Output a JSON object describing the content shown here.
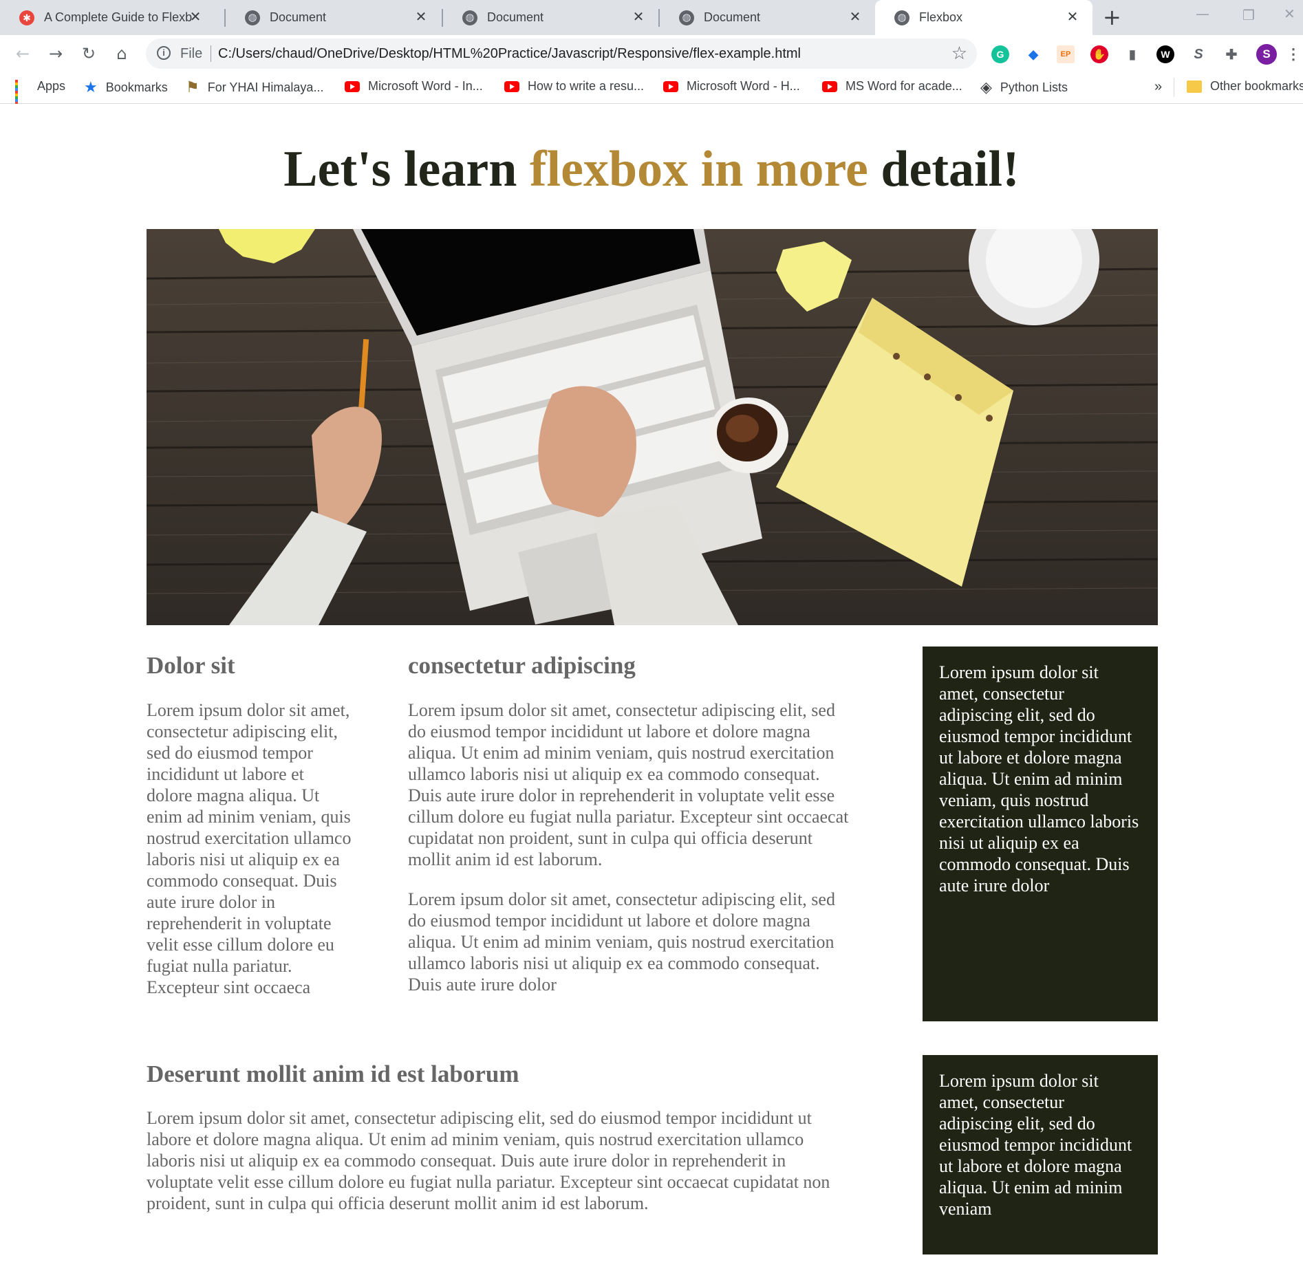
{
  "browser": {
    "tabs": [
      {
        "title": "A Complete Guide to Flexbox",
        "favicon": "guide-icon"
      },
      {
        "title": "Document",
        "favicon": "globe-icon"
      },
      {
        "title": "Document",
        "favicon": "globe-icon"
      },
      {
        "title": "Document",
        "favicon": "globe-icon"
      },
      {
        "title": "Flexbox",
        "favicon": "globe-icon",
        "active": true
      }
    ],
    "omnibox": {
      "scheme": "File",
      "url": "C:/Users/chaud/OneDrive/Desktop/HTML%20Practice/Javascript/Responsive/flex-example.html"
    },
    "profile_initial": "S",
    "bookmarks": [
      {
        "label": "Apps",
        "icon": "apps-icon"
      },
      {
        "label": "Bookmarks",
        "icon": "star-icon"
      },
      {
        "label": "For YHAI Himalaya...",
        "icon": "signpost-icon"
      },
      {
        "label": "Microsoft Word - In...",
        "icon": "youtube-icon"
      },
      {
        "label": "How to write a resu...",
        "icon": "youtube-icon"
      },
      {
        "label": "Microsoft Word - H...",
        "icon": "youtube-icon"
      },
      {
        "label": "MS Word for acade...",
        "icon": "youtube-icon"
      },
      {
        "label": "Python Lists",
        "icon": "python-icon"
      }
    ],
    "overflow": "»",
    "other_bookmarks": "Other bookmarks"
  },
  "page": {
    "title_before": "Let's learn ",
    "title_accent": "flexbox in more",
    "title_after": " detail!",
    "colors": {
      "heading": "#22261a",
      "accent": "#b38935",
      "text": "#666666",
      "aside_bg": "#1f2414"
    },
    "hero_image": "laptop-desk-photo",
    "sections": {
      "col1": {
        "heading": "Dolor sit",
        "text": "Lorem ipsum dolor sit amet, consectetur adipiscing elit, sed do eiusmod tempor incididunt ut labore et dolore magna aliqua. Ut enim ad minim veniam, quis nostrud exercitation ullamco laboris nisi ut aliquip ex ea commodo consequat. Duis aute irure dolor in reprehenderit in voluptate velit esse cillum dolore eu fugiat nulla pariatur. Excepteur sint occaeca"
      },
      "col2": {
        "heading": "consectetur adipiscing",
        "text1": "Lorem ipsum dolor sit amet, consectetur adipiscing elit, sed do eiusmod tempor incididunt ut labore et dolore magna aliqua. Ut enim ad minim veniam, quis nostrud exercitation ullamco laboris nisi ut aliquip ex ea commodo consequat. Duis aute irure dolor in reprehenderit in voluptate velit esse cillum dolore eu fugiat nulla pariatur. Excepteur sint occaecat cupidatat non proident, sunt in culpa qui officia deserunt mollit anim id est laborum.",
        "text2": "Lorem ipsum dolor sit amet, consectetur adipiscing elit, sed do eiusmod tempor incididunt ut labore et dolore magna aliqua. Ut enim ad minim veniam, quis nostrud exercitation ullamco laboris nisi ut aliquip ex ea commodo consequat. Duis aute irure dolor"
      },
      "aside1": "Lorem ipsum dolor sit amet, consectetur adipiscing elit, sed do eiusmod tempor incididunt ut labore et dolore magna aliqua. Ut enim ad minim veniam, quis nostrud exercitation ullamco laboris nisi ut aliquip ex ea commodo consequat. Duis aute irure dolor",
      "bottom": {
        "heading": "Deserunt mollit anim id est laborum",
        "text": "Lorem ipsum dolor sit amet, consectetur adipiscing elit, sed do eiusmod tempor incididunt ut labore et dolore magna aliqua. Ut enim ad minim veniam, quis nostrud exercitation ullamco laboris nisi ut aliquip ex ea commodo consequat. Duis aute irure dolor in reprehenderit in voluptate velit esse cillum dolore eu fugiat nulla pariatur. Excepteur sint occaecat cupidatat non proident, sunt in culpa qui officia deserunt mollit anim id est laborum."
      },
      "aside2": "Lorem ipsum dolor sit amet, consectetur adipiscing elit, sed do eiusmod tempor incididunt ut labore et dolore magna aliqua. Ut enim ad minim veniam"
    }
  }
}
